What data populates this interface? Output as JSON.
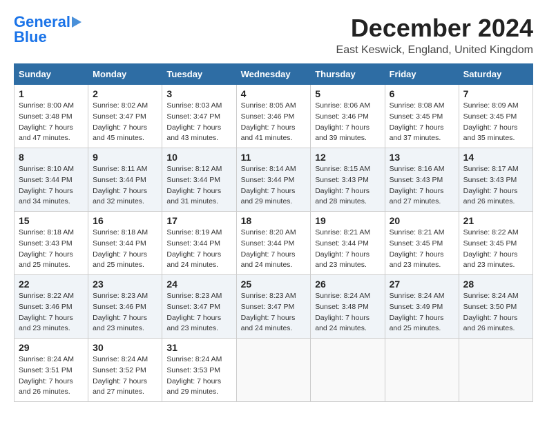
{
  "header": {
    "logo_line1": "General",
    "logo_line2": "Blue",
    "title": "December 2024",
    "subtitle": "East Keswick, England, United Kingdom"
  },
  "weekdays": [
    "Sunday",
    "Monday",
    "Tuesday",
    "Wednesday",
    "Thursday",
    "Friday",
    "Saturday"
  ],
  "weeks": [
    [
      {
        "day": "1",
        "sunrise": "8:00 AM",
        "sunset": "3:48 PM",
        "daylight": "7 hours and 47 minutes."
      },
      {
        "day": "2",
        "sunrise": "8:02 AM",
        "sunset": "3:47 PM",
        "daylight": "7 hours and 45 minutes."
      },
      {
        "day": "3",
        "sunrise": "8:03 AM",
        "sunset": "3:47 PM",
        "daylight": "7 hours and 43 minutes."
      },
      {
        "day": "4",
        "sunrise": "8:05 AM",
        "sunset": "3:46 PM",
        "daylight": "7 hours and 41 minutes."
      },
      {
        "day": "5",
        "sunrise": "8:06 AM",
        "sunset": "3:46 PM",
        "daylight": "7 hours and 39 minutes."
      },
      {
        "day": "6",
        "sunrise": "8:08 AM",
        "sunset": "3:45 PM",
        "daylight": "7 hours and 37 minutes."
      },
      {
        "day": "7",
        "sunrise": "8:09 AM",
        "sunset": "3:45 PM",
        "daylight": "7 hours and 35 minutes."
      }
    ],
    [
      {
        "day": "8",
        "sunrise": "8:10 AM",
        "sunset": "3:44 PM",
        "daylight": "7 hours and 34 minutes."
      },
      {
        "day": "9",
        "sunrise": "8:11 AM",
        "sunset": "3:44 PM",
        "daylight": "7 hours and 32 minutes."
      },
      {
        "day": "10",
        "sunrise": "8:12 AM",
        "sunset": "3:44 PM",
        "daylight": "7 hours and 31 minutes."
      },
      {
        "day": "11",
        "sunrise": "8:14 AM",
        "sunset": "3:44 PM",
        "daylight": "7 hours and 29 minutes."
      },
      {
        "day": "12",
        "sunrise": "8:15 AM",
        "sunset": "3:43 PM",
        "daylight": "7 hours and 28 minutes."
      },
      {
        "day": "13",
        "sunrise": "8:16 AM",
        "sunset": "3:43 PM",
        "daylight": "7 hours and 27 minutes."
      },
      {
        "day": "14",
        "sunrise": "8:17 AM",
        "sunset": "3:43 PM",
        "daylight": "7 hours and 26 minutes."
      }
    ],
    [
      {
        "day": "15",
        "sunrise": "8:18 AM",
        "sunset": "3:43 PM",
        "daylight": "7 hours and 25 minutes."
      },
      {
        "day": "16",
        "sunrise": "8:18 AM",
        "sunset": "3:44 PM",
        "daylight": "7 hours and 25 minutes."
      },
      {
        "day": "17",
        "sunrise": "8:19 AM",
        "sunset": "3:44 PM",
        "daylight": "7 hours and 24 minutes."
      },
      {
        "day": "18",
        "sunrise": "8:20 AM",
        "sunset": "3:44 PM",
        "daylight": "7 hours and 24 minutes."
      },
      {
        "day": "19",
        "sunrise": "8:21 AM",
        "sunset": "3:44 PM",
        "daylight": "7 hours and 23 minutes."
      },
      {
        "day": "20",
        "sunrise": "8:21 AM",
        "sunset": "3:45 PM",
        "daylight": "7 hours and 23 minutes."
      },
      {
        "day": "21",
        "sunrise": "8:22 AM",
        "sunset": "3:45 PM",
        "daylight": "7 hours and 23 minutes."
      }
    ],
    [
      {
        "day": "22",
        "sunrise": "8:22 AM",
        "sunset": "3:46 PM",
        "daylight": "7 hours and 23 minutes."
      },
      {
        "day": "23",
        "sunrise": "8:23 AM",
        "sunset": "3:46 PM",
        "daylight": "7 hours and 23 minutes."
      },
      {
        "day": "24",
        "sunrise": "8:23 AM",
        "sunset": "3:47 PM",
        "daylight": "7 hours and 23 minutes."
      },
      {
        "day": "25",
        "sunrise": "8:23 AM",
        "sunset": "3:47 PM",
        "daylight": "7 hours and 24 minutes."
      },
      {
        "day": "26",
        "sunrise": "8:24 AM",
        "sunset": "3:48 PM",
        "daylight": "7 hours and 24 minutes."
      },
      {
        "day": "27",
        "sunrise": "8:24 AM",
        "sunset": "3:49 PM",
        "daylight": "7 hours and 25 minutes."
      },
      {
        "day": "28",
        "sunrise": "8:24 AM",
        "sunset": "3:50 PM",
        "daylight": "7 hours and 26 minutes."
      }
    ],
    [
      {
        "day": "29",
        "sunrise": "8:24 AM",
        "sunset": "3:51 PM",
        "daylight": "7 hours and 26 minutes."
      },
      {
        "day": "30",
        "sunrise": "8:24 AM",
        "sunset": "3:52 PM",
        "daylight": "7 hours and 27 minutes."
      },
      {
        "day": "31",
        "sunrise": "8:24 AM",
        "sunset": "3:53 PM",
        "daylight": "7 hours and 29 minutes."
      },
      null,
      null,
      null,
      null
    ]
  ]
}
